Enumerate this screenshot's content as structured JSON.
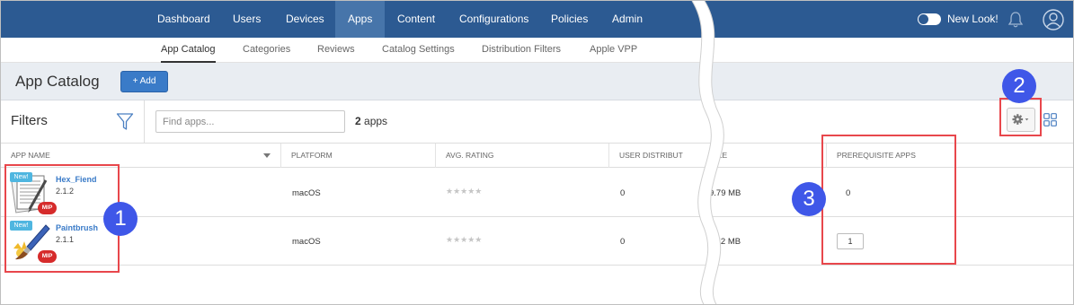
{
  "nav": {
    "items": [
      {
        "label": "Dashboard"
      },
      {
        "label": "Users"
      },
      {
        "label": "Devices"
      },
      {
        "label": "Apps"
      },
      {
        "label": "Content"
      },
      {
        "label": "Configurations"
      },
      {
        "label": "Policies"
      },
      {
        "label": "Admin"
      }
    ],
    "active": "Apps",
    "new_look_label": "New Look!"
  },
  "subnav": {
    "items": [
      {
        "label": "App Catalog"
      },
      {
        "label": "Categories"
      },
      {
        "label": "Reviews"
      },
      {
        "label": "Catalog Settings"
      },
      {
        "label": "Distribution Filters"
      },
      {
        "label": "Apple VPP"
      }
    ],
    "active": "App Catalog"
  },
  "header": {
    "title": "App Catalog",
    "add_label": "+ Add"
  },
  "filters": {
    "label": "Filters",
    "search_placeholder": "Find apps...",
    "count_number": "2",
    "count_unit": "apps"
  },
  "table": {
    "columns": [
      "APP NAME",
      "PLATFORM",
      "AVG. RATING",
      "USER DISTRIBUT",
      "IZE",
      "PREREQUISITE APPS"
    ],
    "rows": [
      {
        "name": "Hex_Fiend",
        "version": "2.1.2",
        "new_badge": "New!",
        "mip_badge": "MIP",
        "platform": "macOS",
        "rating": "★★★★★",
        "user_distribution": "0",
        "size": "9.79 MB",
        "prerequisite": "0",
        "icon": "hex-fiend-app-icon"
      },
      {
        "name": "Paintbrush",
        "version": "2.1.1",
        "new_badge": "New!",
        "mip_badge": "MIP",
        "platform": "macOS",
        "rating": "★★★★★",
        "user_distribution": "0",
        "size": ".52 MB",
        "prerequisite": "1",
        "icon": "paintbrush-app-icon"
      }
    ]
  },
  "callouts": [
    "1",
    "2",
    "3"
  ],
  "colors": {
    "nav_bg": "#2c5a92",
    "nav_active": "#4775aa",
    "accent_blue": "#3a7bc8",
    "callout_blue": "#3f57e8",
    "highlight_red": "#e8474c",
    "mip_red": "#d62b2b",
    "new_badge": "#4fb6e0"
  }
}
